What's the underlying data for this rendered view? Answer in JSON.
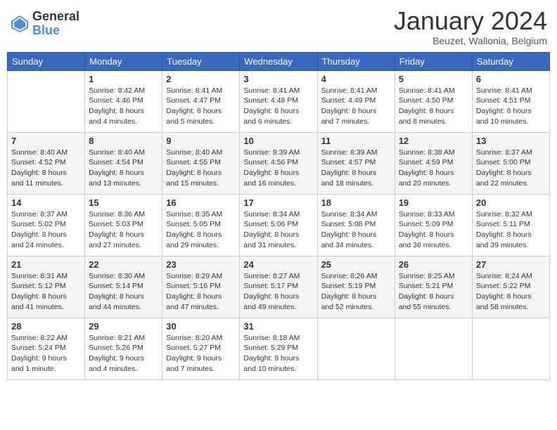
{
  "header": {
    "logo": {
      "general": "General",
      "blue": "Blue"
    },
    "title": "January 2024",
    "subtitle": "Beuzet, Wallonia, Belgium"
  },
  "calendar": {
    "days_of_week": [
      "Sunday",
      "Monday",
      "Tuesday",
      "Wednesday",
      "Thursday",
      "Friday",
      "Saturday"
    ],
    "weeks": [
      [
        {
          "day": "",
          "sunrise": "",
          "sunset": "",
          "daylight": ""
        },
        {
          "day": "1",
          "sunrise": "Sunrise: 8:42 AM",
          "sunset": "Sunset: 4:46 PM",
          "daylight": "Daylight: 8 hours and 4 minutes."
        },
        {
          "day": "2",
          "sunrise": "Sunrise: 8:41 AM",
          "sunset": "Sunset: 4:47 PM",
          "daylight": "Daylight: 8 hours and 5 minutes."
        },
        {
          "day": "3",
          "sunrise": "Sunrise: 8:41 AM",
          "sunset": "Sunset: 4:48 PM",
          "daylight": "Daylight: 8 hours and 6 minutes."
        },
        {
          "day": "4",
          "sunrise": "Sunrise: 8:41 AM",
          "sunset": "Sunset: 4:49 PM",
          "daylight": "Daylight: 8 hours and 7 minutes."
        },
        {
          "day": "5",
          "sunrise": "Sunrise: 8:41 AM",
          "sunset": "Sunset: 4:50 PM",
          "daylight": "Daylight: 8 hours and 8 minutes."
        },
        {
          "day": "6",
          "sunrise": "Sunrise: 8:41 AM",
          "sunset": "Sunset: 4:51 PM",
          "daylight": "Daylight: 8 hours and 10 minutes."
        }
      ],
      [
        {
          "day": "7",
          "sunrise": "Sunrise: 8:40 AM",
          "sunset": "Sunset: 4:52 PM",
          "daylight": "Daylight: 8 hours and 11 minutes."
        },
        {
          "day": "8",
          "sunrise": "Sunrise: 8:40 AM",
          "sunset": "Sunset: 4:54 PM",
          "daylight": "Daylight: 8 hours and 13 minutes."
        },
        {
          "day": "9",
          "sunrise": "Sunrise: 8:40 AM",
          "sunset": "Sunset: 4:55 PM",
          "daylight": "Daylight: 8 hours and 15 minutes."
        },
        {
          "day": "10",
          "sunrise": "Sunrise: 8:39 AM",
          "sunset": "Sunset: 4:56 PM",
          "daylight": "Daylight: 8 hours and 16 minutes."
        },
        {
          "day": "11",
          "sunrise": "Sunrise: 8:39 AM",
          "sunset": "Sunset: 4:57 PM",
          "daylight": "Daylight: 8 hours and 18 minutes."
        },
        {
          "day": "12",
          "sunrise": "Sunrise: 8:38 AM",
          "sunset": "Sunset: 4:59 PM",
          "daylight": "Daylight: 8 hours and 20 minutes."
        },
        {
          "day": "13",
          "sunrise": "Sunrise: 8:37 AM",
          "sunset": "Sunset: 5:00 PM",
          "daylight": "Daylight: 8 hours and 22 minutes."
        }
      ],
      [
        {
          "day": "14",
          "sunrise": "Sunrise: 8:37 AM",
          "sunset": "Sunset: 5:02 PM",
          "daylight": "Daylight: 8 hours and 24 minutes."
        },
        {
          "day": "15",
          "sunrise": "Sunrise: 8:36 AM",
          "sunset": "Sunset: 5:03 PM",
          "daylight": "Daylight: 8 hours and 27 minutes."
        },
        {
          "day": "16",
          "sunrise": "Sunrise: 8:35 AM",
          "sunset": "Sunset: 5:05 PM",
          "daylight": "Daylight: 8 hours and 29 minutes."
        },
        {
          "day": "17",
          "sunrise": "Sunrise: 8:34 AM",
          "sunset": "Sunset: 5:06 PM",
          "daylight": "Daylight: 8 hours and 31 minutes."
        },
        {
          "day": "18",
          "sunrise": "Sunrise: 8:34 AM",
          "sunset": "Sunset: 5:08 PM",
          "daylight": "Daylight: 8 hours and 34 minutes."
        },
        {
          "day": "19",
          "sunrise": "Sunrise: 8:33 AM",
          "sunset": "Sunset: 5:09 PM",
          "daylight": "Daylight: 8 hours and 36 minutes."
        },
        {
          "day": "20",
          "sunrise": "Sunrise: 8:32 AM",
          "sunset": "Sunset: 5:11 PM",
          "daylight": "Daylight: 8 hours and 39 minutes."
        }
      ],
      [
        {
          "day": "21",
          "sunrise": "Sunrise: 8:31 AM",
          "sunset": "Sunset: 5:12 PM",
          "daylight": "Daylight: 8 hours and 41 minutes."
        },
        {
          "day": "22",
          "sunrise": "Sunrise: 8:30 AM",
          "sunset": "Sunset: 5:14 PM",
          "daylight": "Daylight: 8 hours and 44 minutes."
        },
        {
          "day": "23",
          "sunrise": "Sunrise: 8:29 AM",
          "sunset": "Sunset: 5:16 PM",
          "daylight": "Daylight: 8 hours and 47 minutes."
        },
        {
          "day": "24",
          "sunrise": "Sunrise: 8:27 AM",
          "sunset": "Sunset: 5:17 PM",
          "daylight": "Daylight: 8 hours and 49 minutes."
        },
        {
          "day": "25",
          "sunrise": "Sunrise: 8:26 AM",
          "sunset": "Sunset: 5:19 PM",
          "daylight": "Daylight: 8 hours and 52 minutes."
        },
        {
          "day": "26",
          "sunrise": "Sunrise: 8:25 AM",
          "sunset": "Sunset: 5:21 PM",
          "daylight": "Daylight: 8 hours and 55 minutes."
        },
        {
          "day": "27",
          "sunrise": "Sunrise: 8:24 AM",
          "sunset": "Sunset: 5:22 PM",
          "daylight": "Daylight: 8 hours and 58 minutes."
        }
      ],
      [
        {
          "day": "28",
          "sunrise": "Sunrise: 8:22 AM",
          "sunset": "Sunset: 5:24 PM",
          "daylight": "Daylight: 9 hours and 1 minute."
        },
        {
          "day": "29",
          "sunrise": "Sunrise: 8:21 AM",
          "sunset": "Sunset: 5:26 PM",
          "daylight": "Daylight: 9 hours and 4 minutes."
        },
        {
          "day": "30",
          "sunrise": "Sunrise: 8:20 AM",
          "sunset": "Sunset: 5:27 PM",
          "daylight": "Daylight: 9 hours and 7 minutes."
        },
        {
          "day": "31",
          "sunrise": "Sunrise: 8:18 AM",
          "sunset": "Sunset: 5:29 PM",
          "daylight": "Daylight: 9 hours and 10 minutes."
        },
        {
          "day": "",
          "sunrise": "",
          "sunset": "",
          "daylight": ""
        },
        {
          "day": "",
          "sunrise": "",
          "sunset": "",
          "daylight": ""
        },
        {
          "day": "",
          "sunrise": "",
          "sunset": "",
          "daylight": ""
        }
      ]
    ]
  }
}
